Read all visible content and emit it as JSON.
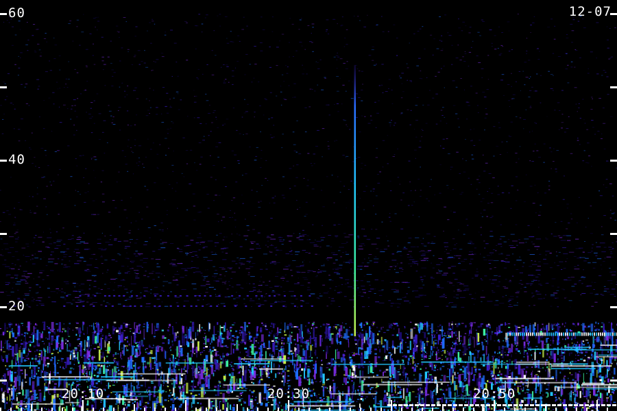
{
  "chart_data": {
    "type": "heatmap",
    "date": "12-07",
    "y_ticks": [
      60,
      40,
      20
    ],
    "y_minor_ticks": [
      50,
      30,
      10
    ],
    "ylim": [
      10,
      60
    ],
    "x_tick_labels": [
      "20:10",
      "20:30",
      "20:50"
    ],
    "x_tick_times_min": [
      10,
      30,
      50
    ],
    "xlim_min": [
      2,
      62
    ],
    "vertical_streak": {
      "time_min": 36.5,
      "from_y": 16,
      "to_y": 53
    },
    "noise_band_upper_y": 21,
    "grid": false,
    "colors": {
      "background": "#000000",
      "text": "#ffffff",
      "palette": [
        "#1a0a6e",
        "#3a1cc8",
        "#7a2ce0",
        "#1f6cff",
        "#22c8ff",
        "#3cf0a0",
        "#c8f048",
        "#ffffff"
      ]
    }
  }
}
